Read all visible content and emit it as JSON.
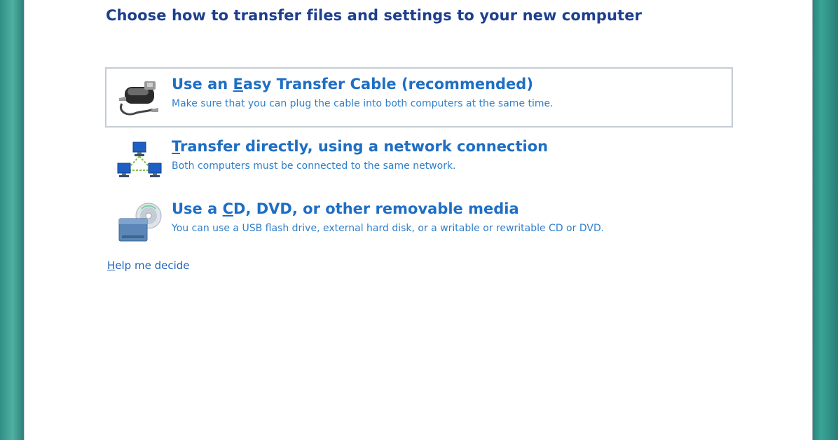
{
  "wizard": {
    "title": "Choose how to transfer files and settings to your new computer",
    "options": [
      {
        "heading_pre": "Use an ",
        "heading_key": "E",
        "heading_post": "asy Transfer Cable (recommended)",
        "description": "Make sure that you can plug the cable into both computers at the same time.",
        "icon": "cable-icon",
        "selected": true
      },
      {
        "heading_pre": "",
        "heading_key": "T",
        "heading_post": "ransfer directly, using a network connection",
        "description": "Both computers must be connected to the same network.",
        "icon": "network-computers-icon",
        "selected": false
      },
      {
        "heading_pre": "Use a ",
        "heading_key": "C",
        "heading_post": "D, DVD, or other removable media",
        "description": "You can use a USB flash drive, external hard disk, or a writable or rewritable CD or DVD.",
        "icon": "removable-media-icon",
        "selected": false
      }
    ],
    "help": {
      "key": "H",
      "rest": "elp me decide"
    }
  },
  "colors": {
    "title": "#1e3f8f",
    "option_heading": "#1e6ec4",
    "option_description": "#2f7fc9",
    "selection_border": "#c6ccd4"
  }
}
